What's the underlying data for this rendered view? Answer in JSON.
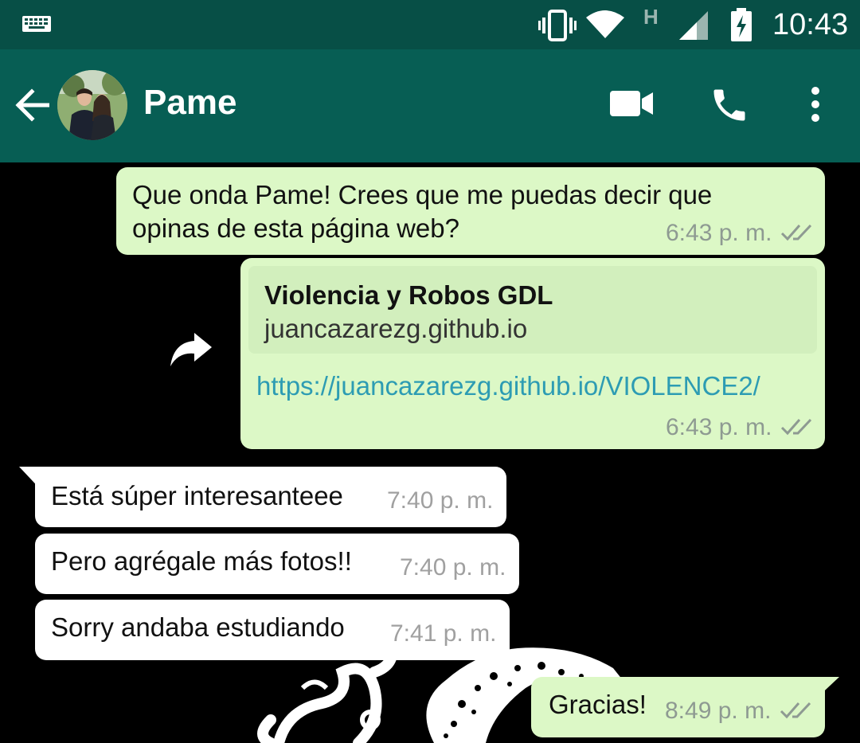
{
  "status_bar": {
    "network_letter": "H",
    "time": "10:43"
  },
  "header": {
    "contact_name": "Pame"
  },
  "messages": [
    {
      "direction": "outgoing",
      "lines": [
        "Que onda Pame! Crees que me puedas decir que",
        "opinas de esta página web?"
      ],
      "time": "6:43 p. m.",
      "status": "delivered"
    },
    {
      "direction": "outgoing",
      "preview_title": "Violencia y Robos GDL",
      "preview_domain": "juancazarezg.github.io",
      "link": "https://juancazarezg.github.io/VIOLENCE2/",
      "time": "6:43 p. m.",
      "status": "delivered"
    },
    {
      "direction": "incoming",
      "text": "Está súper interesanteee",
      "time": "7:40 p. m."
    },
    {
      "direction": "incoming",
      "text": "Pero agrégale más fotos!!",
      "time": "7:40 p. m."
    },
    {
      "direction": "incoming",
      "text": "Sorry andaba estudiando",
      "time": "7:41 p. m."
    },
    {
      "direction": "outgoing",
      "text": "Gracias!",
      "time": "8:49 p. m.",
      "status": "delivered"
    }
  ],
  "colors": {
    "status_bar": "#074f46",
    "header": "#075e54",
    "outgoing_bubble": "#dcf8c6",
    "incoming_bubble": "#ffffff",
    "link": "#2d9cb3"
  }
}
